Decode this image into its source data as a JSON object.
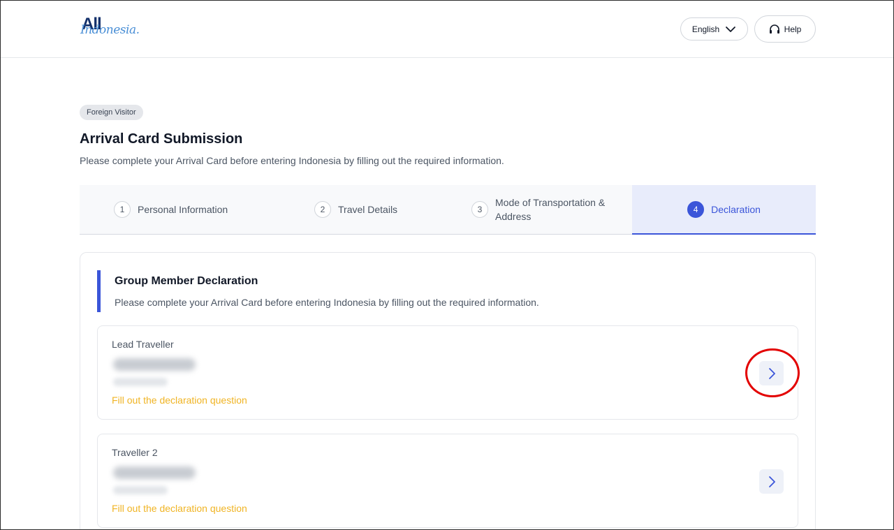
{
  "header": {
    "logo_all": "All",
    "logo_indonesia": "Indonesia.",
    "language_label": "English",
    "help_label": "Help"
  },
  "badge": "Foreign Visitor",
  "page": {
    "title": "Arrival Card Submission",
    "subtitle": "Please complete your Arrival Card before entering Indonesia by filling out the required information."
  },
  "steps": [
    {
      "number": "1",
      "label": "Personal Information"
    },
    {
      "number": "2",
      "label": "Travel Details"
    },
    {
      "number": "3",
      "label_line1": "Mode of Transportation &",
      "label_line2": "Address"
    },
    {
      "number": "4",
      "label": "Declaration",
      "active": true
    }
  ],
  "section": {
    "title": "Group Member Declaration",
    "subtitle": "Please complete your Arrival Card before entering Indonesia by filling out the required information."
  },
  "travellers": [
    {
      "label": "Lead Traveller",
      "status": "Fill out the declaration question"
    },
    {
      "label": "Traveller 2",
      "status": "Fill out the declaration question"
    }
  ],
  "colors": {
    "accent": "#3b55d9",
    "status_pending": "#f0b424",
    "highlight": "#e30000"
  },
  "icons": {
    "language": "chevron-down-icon",
    "help": "headset-icon",
    "traveller_action": "chevron-right-icon"
  }
}
